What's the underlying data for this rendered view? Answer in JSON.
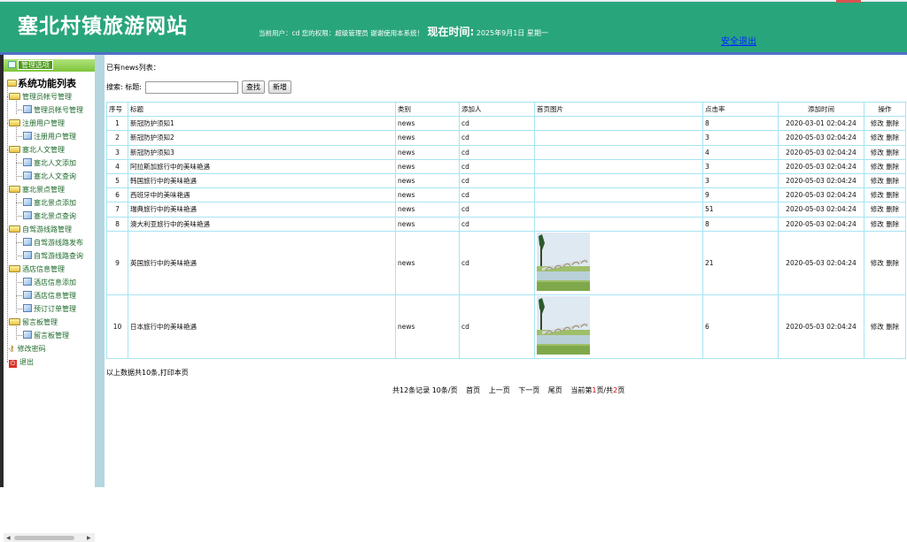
{
  "header": {
    "site_title": "塞北村镇旅游网站",
    "user_info": "当前用户：cd 您的权限：超级管理员 谢谢使用本系统！",
    "time_label": "现在时间:",
    "time_value": "2025年9月1日 星期一",
    "logout": "安全退出"
  },
  "sidebar": {
    "head_label": "管理选项",
    "root": "系统功能列表",
    "groups": [
      {
        "label": "管理员帐号管理",
        "items": [
          "管理员帐号管理"
        ]
      },
      {
        "label": "注册用户管理",
        "items": [
          "注册用户管理"
        ]
      },
      {
        "label": "塞北人文管理",
        "items": [
          "塞北人文添加",
          "塞北人文查询"
        ]
      },
      {
        "label": "塞北景点管理",
        "items": [
          "塞北景点添加",
          "塞北景点查询"
        ]
      },
      {
        "label": "自驾游线路管理",
        "items": [
          "自驾游线路发布",
          "自驾游线路查询"
        ]
      },
      {
        "label": "酒店信息管理",
        "items": [
          "酒店信息添加",
          "酒店信息管理",
          "预订订单管理"
        ]
      },
      {
        "label": "留言板管理",
        "items": [
          "留言板管理"
        ]
      }
    ],
    "change_password": "修改密码",
    "exit": "退出"
  },
  "main": {
    "list_caption": "已有news列表：",
    "search_label": "搜索: 标题:",
    "search_value": "",
    "search_button": "查找",
    "add_button": "新增",
    "columns": [
      "序号",
      "标题",
      "类别",
      "添加人",
      "首页图片",
      "点击率",
      "添加时间",
      "操作"
    ],
    "rows": [
      {
        "no": "1",
        "title": "新冠防护须知1",
        "category": "news",
        "author": "cd",
        "has_image": false,
        "clicks": "8",
        "time": "2020-03-01 02:04:24"
      },
      {
        "no": "2",
        "title": "新冠防护须知2",
        "category": "news",
        "author": "cd",
        "has_image": false,
        "clicks": "3",
        "time": "2020-05-03 02:04:24"
      },
      {
        "no": "3",
        "title": "新冠防护须知3",
        "category": "news",
        "author": "cd",
        "has_image": false,
        "clicks": "4",
        "time": "2020-05-03 02:04:24"
      },
      {
        "no": "4",
        "title": "阿拉斯加旅行中的美味艳遇",
        "category": "news",
        "author": "cd",
        "has_image": false,
        "clicks": "3",
        "time": "2020-05-03 02:04:24"
      },
      {
        "no": "5",
        "title": "韩国旅行中的美味艳遇",
        "category": "news",
        "author": "cd",
        "has_image": false,
        "clicks": "3",
        "time": "2020-05-03 02:04:24"
      },
      {
        "no": "6",
        "title": "西班牙中的美味艳遇",
        "category": "news",
        "author": "cd",
        "has_image": false,
        "clicks": "9",
        "time": "2020-05-03 02:04:24"
      },
      {
        "no": "7",
        "title": "瑞典旅行中的美味艳遇",
        "category": "news",
        "author": "cd",
        "has_image": false,
        "clicks": "51",
        "time": "2020-05-03 02:04:24"
      },
      {
        "no": "8",
        "title": "澳大利亚旅行中的美味艳遇",
        "category": "news",
        "author": "cd",
        "has_image": false,
        "clicks": "8",
        "time": "2020-05-03 02:04:24"
      },
      {
        "no": "9",
        "title": "英国旅行中的美味艳遇",
        "category": "news",
        "author": "cd",
        "has_image": true,
        "clicks": "21",
        "time": "2020-05-03 02:04:24"
      },
      {
        "no": "10",
        "title": "日本旅行中的美味艳遇",
        "category": "news",
        "author": "cd",
        "has_image": true,
        "clicks": "6",
        "time": "2020-05-03 02:04:24"
      }
    ],
    "action_edit": "修改",
    "action_delete": "删除",
    "summary": "以上数据共10条,打印本页",
    "pager": {
      "total": "共12条记录 10条/页",
      "first": "首页",
      "prev": "上一页",
      "next": "下一页",
      "last": "尾页",
      "current_prefix": "当前第",
      "current_page": "1",
      "current_mid": "页/共",
      "total_pages": "2",
      "current_suffix": "页"
    }
  },
  "colors": {
    "header_bg": "#29a57c",
    "header_stripe": "#4f6fc8",
    "table_border": "#a6e4f2",
    "sidebar_right": "#b5d6e0"
  }
}
